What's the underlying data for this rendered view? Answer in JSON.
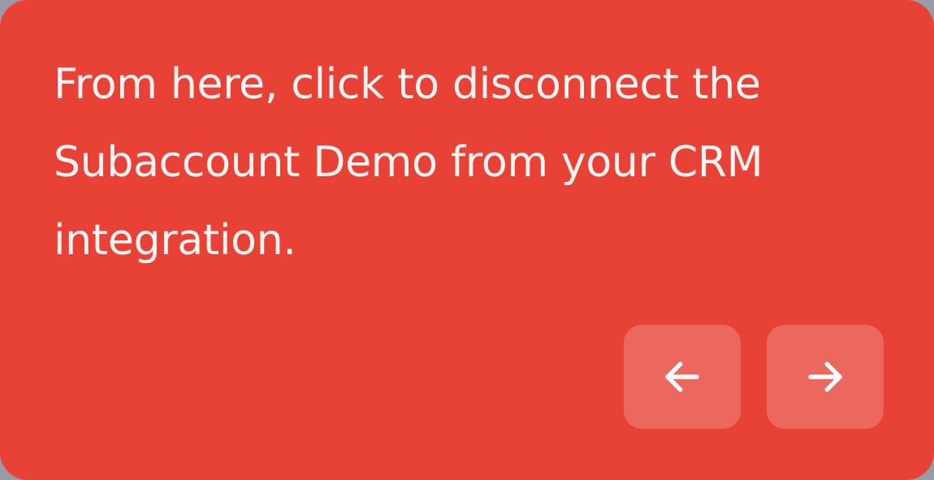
{
  "tooltip": {
    "message": "From here, click to disconnect the Subaccount Demo from your CRM integration.",
    "prev_icon": "arrow-left-icon",
    "next_icon": "arrow-right-icon",
    "colors": {
      "background": "#e84236",
      "text": "#fff4f2",
      "button_fill": "rgba(255,255,255,0.2)"
    }
  }
}
